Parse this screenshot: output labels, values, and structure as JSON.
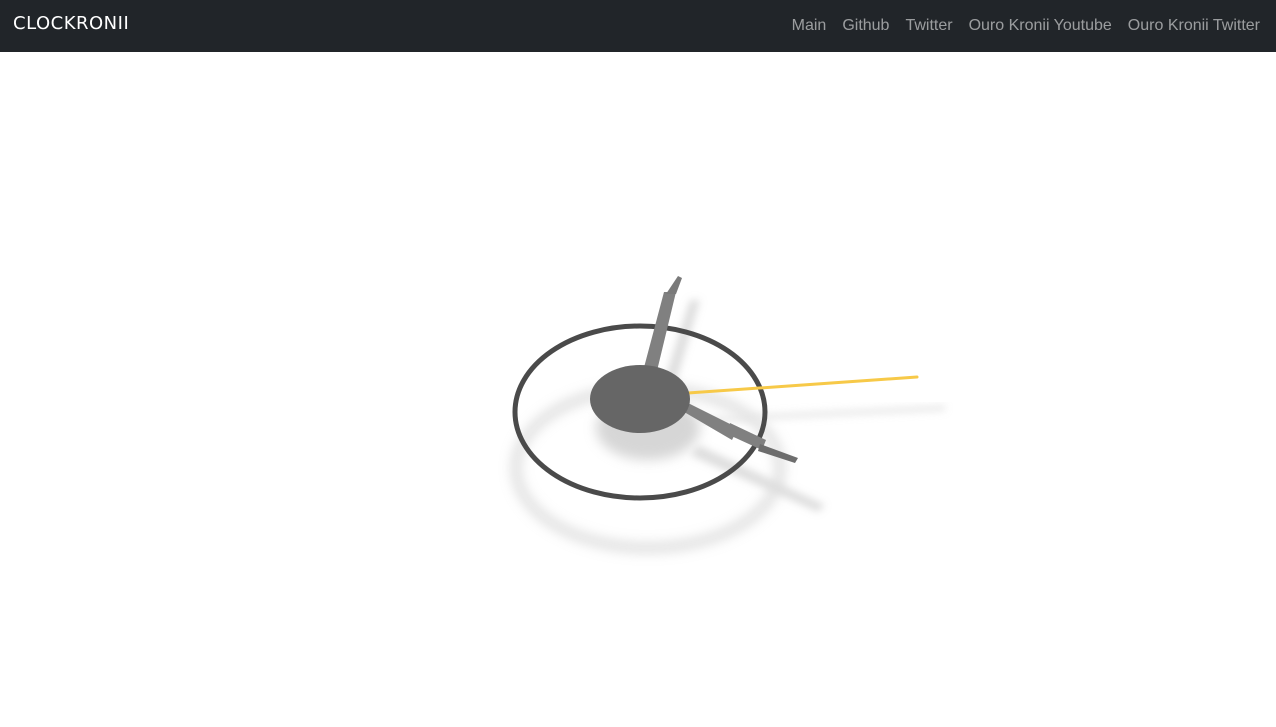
{
  "navbar": {
    "brand": "CLOCKRONII",
    "links": [
      {
        "label": "Main"
      },
      {
        "label": "Github"
      },
      {
        "label": "Twitter"
      },
      {
        "label": "Ouro Kronii Youtube"
      },
      {
        "label": "Ouro Kronii Twitter"
      }
    ]
  },
  "colors": {
    "navbar_bg": "#212529",
    "ring": "#4a4a4a",
    "hub": "#666666",
    "hands": "#808080",
    "second_hand": "#f7c948",
    "shadow": "#cfcfcf"
  }
}
